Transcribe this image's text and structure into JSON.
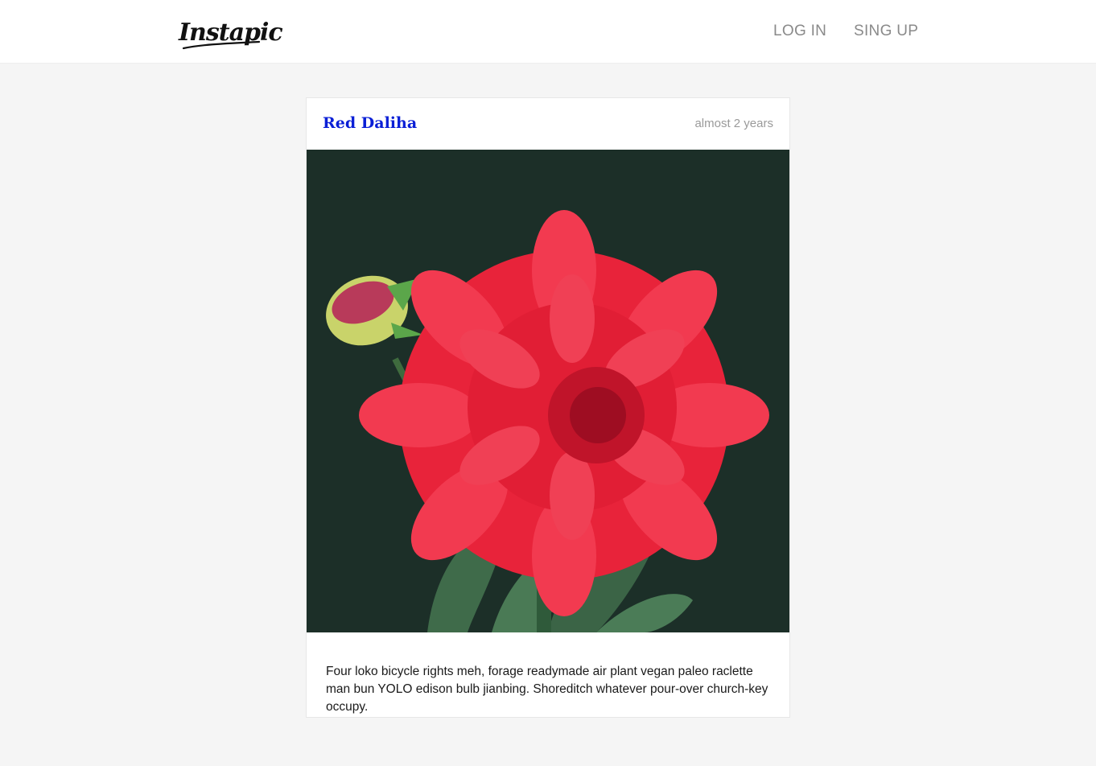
{
  "header": {
    "logo_text": "Instapic",
    "nav": {
      "login_label": "LOG IN",
      "signup_label": "SING UP"
    }
  },
  "post": {
    "title": "Red Daliha",
    "time": "almost 2 years",
    "image_alt": "Red dahlia flower with a bud on a dark green background",
    "caption": "Four loko bicycle rights meh, forage readymade air plant vegan paleo raclette man bun YOLO edison bulb jianbing. Shoreditch whatever pour-over church-key occupy."
  },
  "colors": {
    "title_link": "#0a1fd6",
    "photo_background": "#1c2f28",
    "petal": "#e8233a",
    "leaf": "#3f6b4a"
  }
}
